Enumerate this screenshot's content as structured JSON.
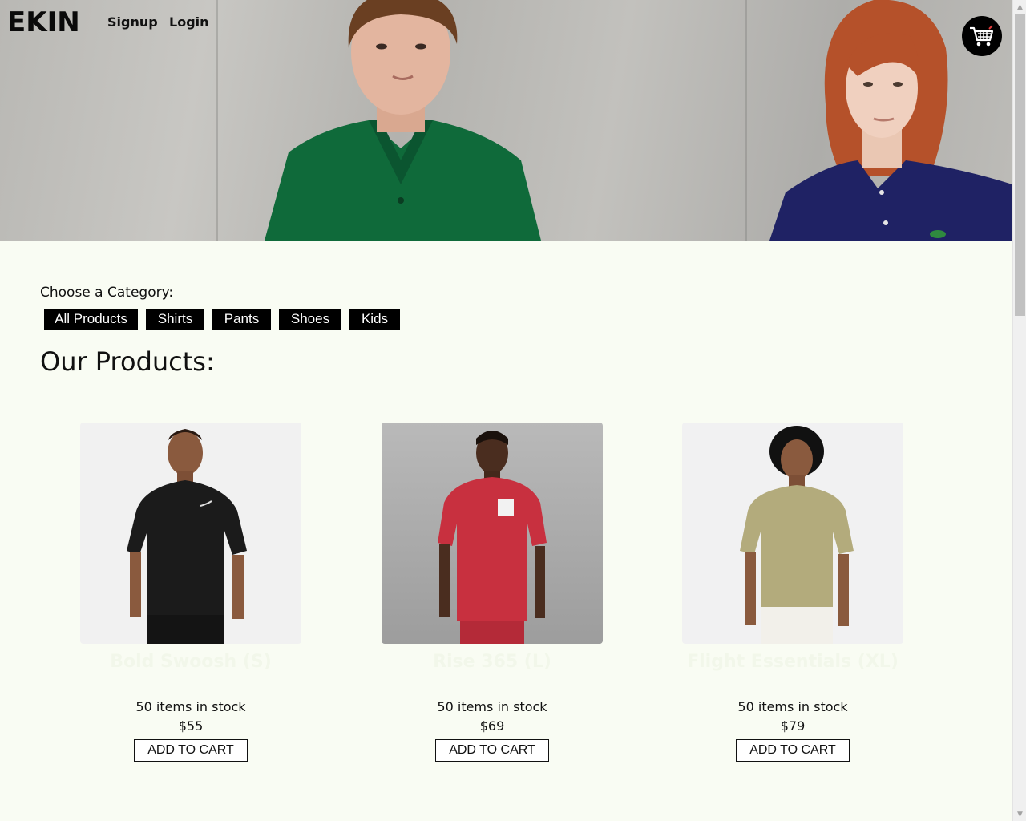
{
  "header": {
    "logo": "EKIN",
    "nav": {
      "signup": "Signup",
      "login": "Login"
    },
    "cart_icon": "shopping-cart-icon"
  },
  "category": {
    "label": "Choose a Category:",
    "buttons": [
      "All Products",
      "Shirts",
      "Pants",
      "Shoes",
      "Kids"
    ]
  },
  "products_title": "Our Products:",
  "products": [
    {
      "name": "Bold Swoosh (S)",
      "stock": "50 items in stock",
      "price": "$55",
      "button": "ADD TO CART",
      "shirt_color": "#1b1b1b",
      "bg": "#f1f1f1"
    },
    {
      "name": "Rise 365 (L)",
      "stock": "50 items in stock",
      "price": "$69",
      "button": "ADD TO CART",
      "shirt_color": "#c8303f",
      "bg": "#b7b7b7"
    },
    {
      "name": "Flight Essentials (XL)",
      "stock": "50 items in stock",
      "price": "$79",
      "button": "ADD TO CART",
      "shirt_color": "#b3ab7c",
      "bg": "#f1f1f2"
    }
  ],
  "colors": {
    "page_bg": "#f9fcf3",
    "button_bg": "#000000"
  }
}
